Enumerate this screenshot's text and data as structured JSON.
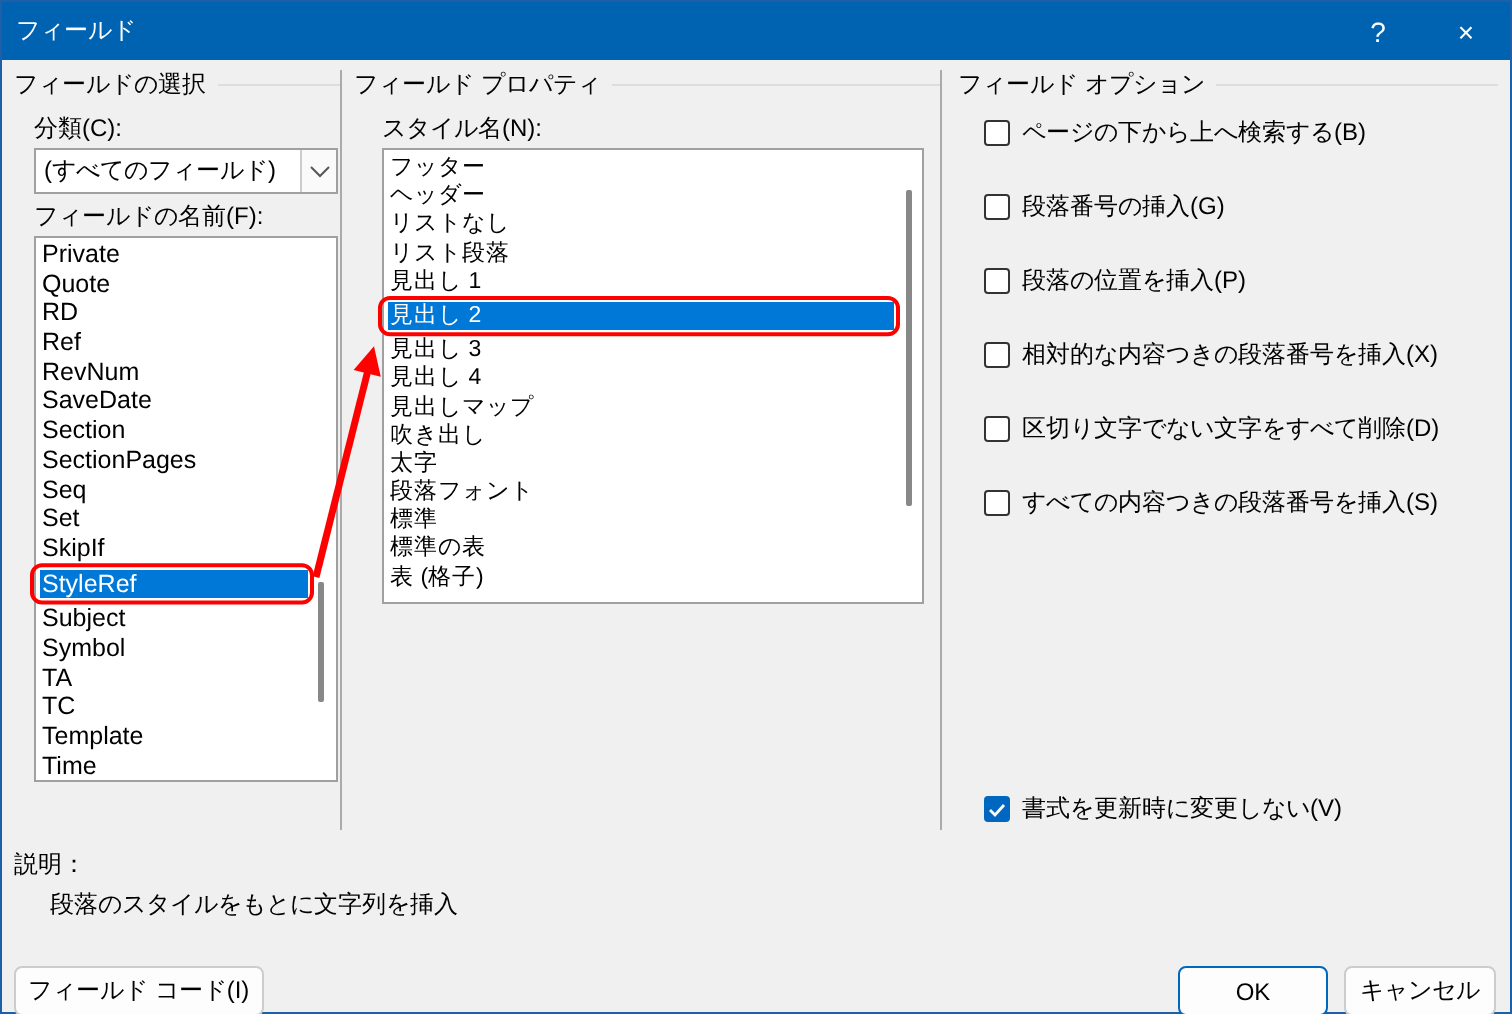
{
  "window": {
    "title": "フィールド",
    "help": "?",
    "close": "×"
  },
  "field_selection": {
    "title": "フィールドの選択",
    "category_label": "分類(C):",
    "category_value": "(すべてのフィールド)",
    "names_label": "フィールドの名前(F):",
    "names": [
      {
        "label": "Private",
        "selected": false
      },
      {
        "label": "Quote",
        "selected": false
      },
      {
        "label": "RD",
        "selected": false
      },
      {
        "label": "Ref",
        "selected": false
      },
      {
        "label": "RevNum",
        "selected": false
      },
      {
        "label": "SaveDate",
        "selected": false
      },
      {
        "label": "Section",
        "selected": false
      },
      {
        "label": "SectionPages",
        "selected": false
      },
      {
        "label": "Seq",
        "selected": false
      },
      {
        "label": "Set",
        "selected": false
      },
      {
        "label": "SkipIf",
        "selected": false
      },
      {
        "label": "StyleRef",
        "selected": true
      },
      {
        "label": "Subject",
        "selected": false
      },
      {
        "label": "Symbol",
        "selected": false
      },
      {
        "label": "TA",
        "selected": false
      },
      {
        "label": "TC",
        "selected": false
      },
      {
        "label": "Template",
        "selected": false
      },
      {
        "label": "Time",
        "selected": false
      }
    ]
  },
  "field_properties": {
    "title": "フィールド プロパティ",
    "styles_label": "スタイル名(N):",
    "styles": [
      {
        "label": "フッター",
        "selected": false
      },
      {
        "label": "ヘッダー",
        "selected": false
      },
      {
        "label": "リストなし",
        "selected": false
      },
      {
        "label": "リスト段落",
        "selected": false
      },
      {
        "label": "見出し 1",
        "selected": false
      },
      {
        "label": "見出し 2",
        "selected": true
      },
      {
        "label": "見出し 3",
        "selected": false
      },
      {
        "label": "見出し 4",
        "selected": false
      },
      {
        "label": "見出しマップ",
        "selected": false
      },
      {
        "label": "吹き出し",
        "selected": false
      },
      {
        "label": "太字",
        "selected": false
      },
      {
        "label": "段落フォント",
        "selected": false
      },
      {
        "label": "標準",
        "selected": false
      },
      {
        "label": "標準の表",
        "selected": false
      },
      {
        "label": "表 (格子)",
        "selected": false
      }
    ]
  },
  "field_options": {
    "title": "フィールド オプション",
    "options": [
      {
        "label": "ページの下から上へ検索する(B)",
        "checked": false
      },
      {
        "label": "段落番号の挿入(G)",
        "checked": false
      },
      {
        "label": "段落の位置を挿入(P)",
        "checked": false
      },
      {
        "label": "相対的な内容つきの段落番号を挿入(X)",
        "checked": false
      },
      {
        "label": "区切り文字でない文字をすべて削除(D)",
        "checked": false
      },
      {
        "label": "すべての内容つきの段落番号を挿入(S)",
        "checked": false
      }
    ],
    "preserve_format": {
      "label": "書式を更新時に変更しない(V)",
      "checked": true
    }
  },
  "description": {
    "label": "説明：",
    "text": "段落のスタイルをもとに文字列を挿入"
  },
  "buttons": {
    "field_code": "フィールド コード(I)",
    "ok": "OK",
    "cancel": "キャンセル"
  }
}
